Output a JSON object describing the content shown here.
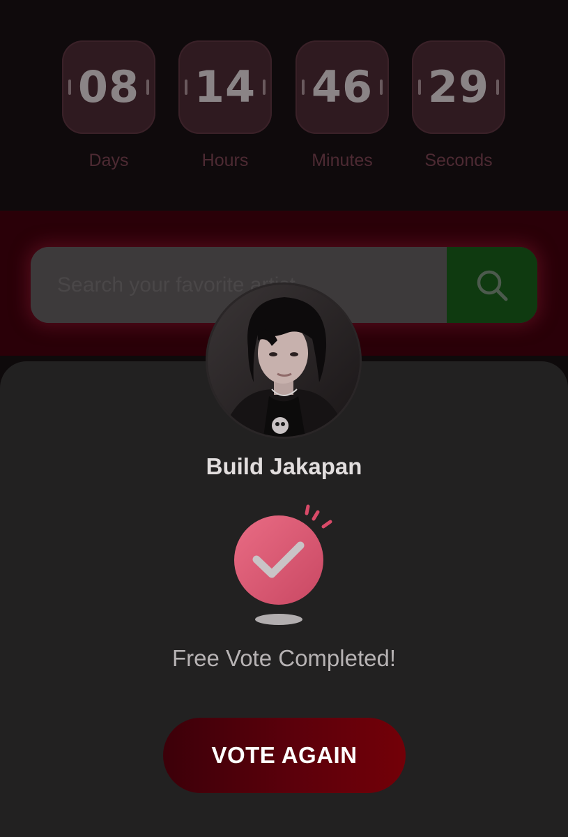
{
  "countdown": {
    "units": [
      {
        "value": "08",
        "label": "Days"
      },
      {
        "value": "14",
        "label": "Hours"
      },
      {
        "value": "46",
        "label": "Minutes"
      },
      {
        "value": "29",
        "label": "Seconds"
      }
    ]
  },
  "search": {
    "placeholder": "Search your favorite artist",
    "button_icon": "search-icon"
  },
  "vote_modal": {
    "artist_name": "Build Jakapan",
    "avatar_icon": "artist-photo",
    "status_icon": "checkmark-icon",
    "status_text": "Free Vote Completed!",
    "vote_again_label": "VOTE AGAIN"
  },
  "colors": {
    "accent": "#e06075",
    "button_gradient_start": "#3c0009",
    "button_gradient_end": "#730008",
    "search_button": "#0f3a10"
  }
}
